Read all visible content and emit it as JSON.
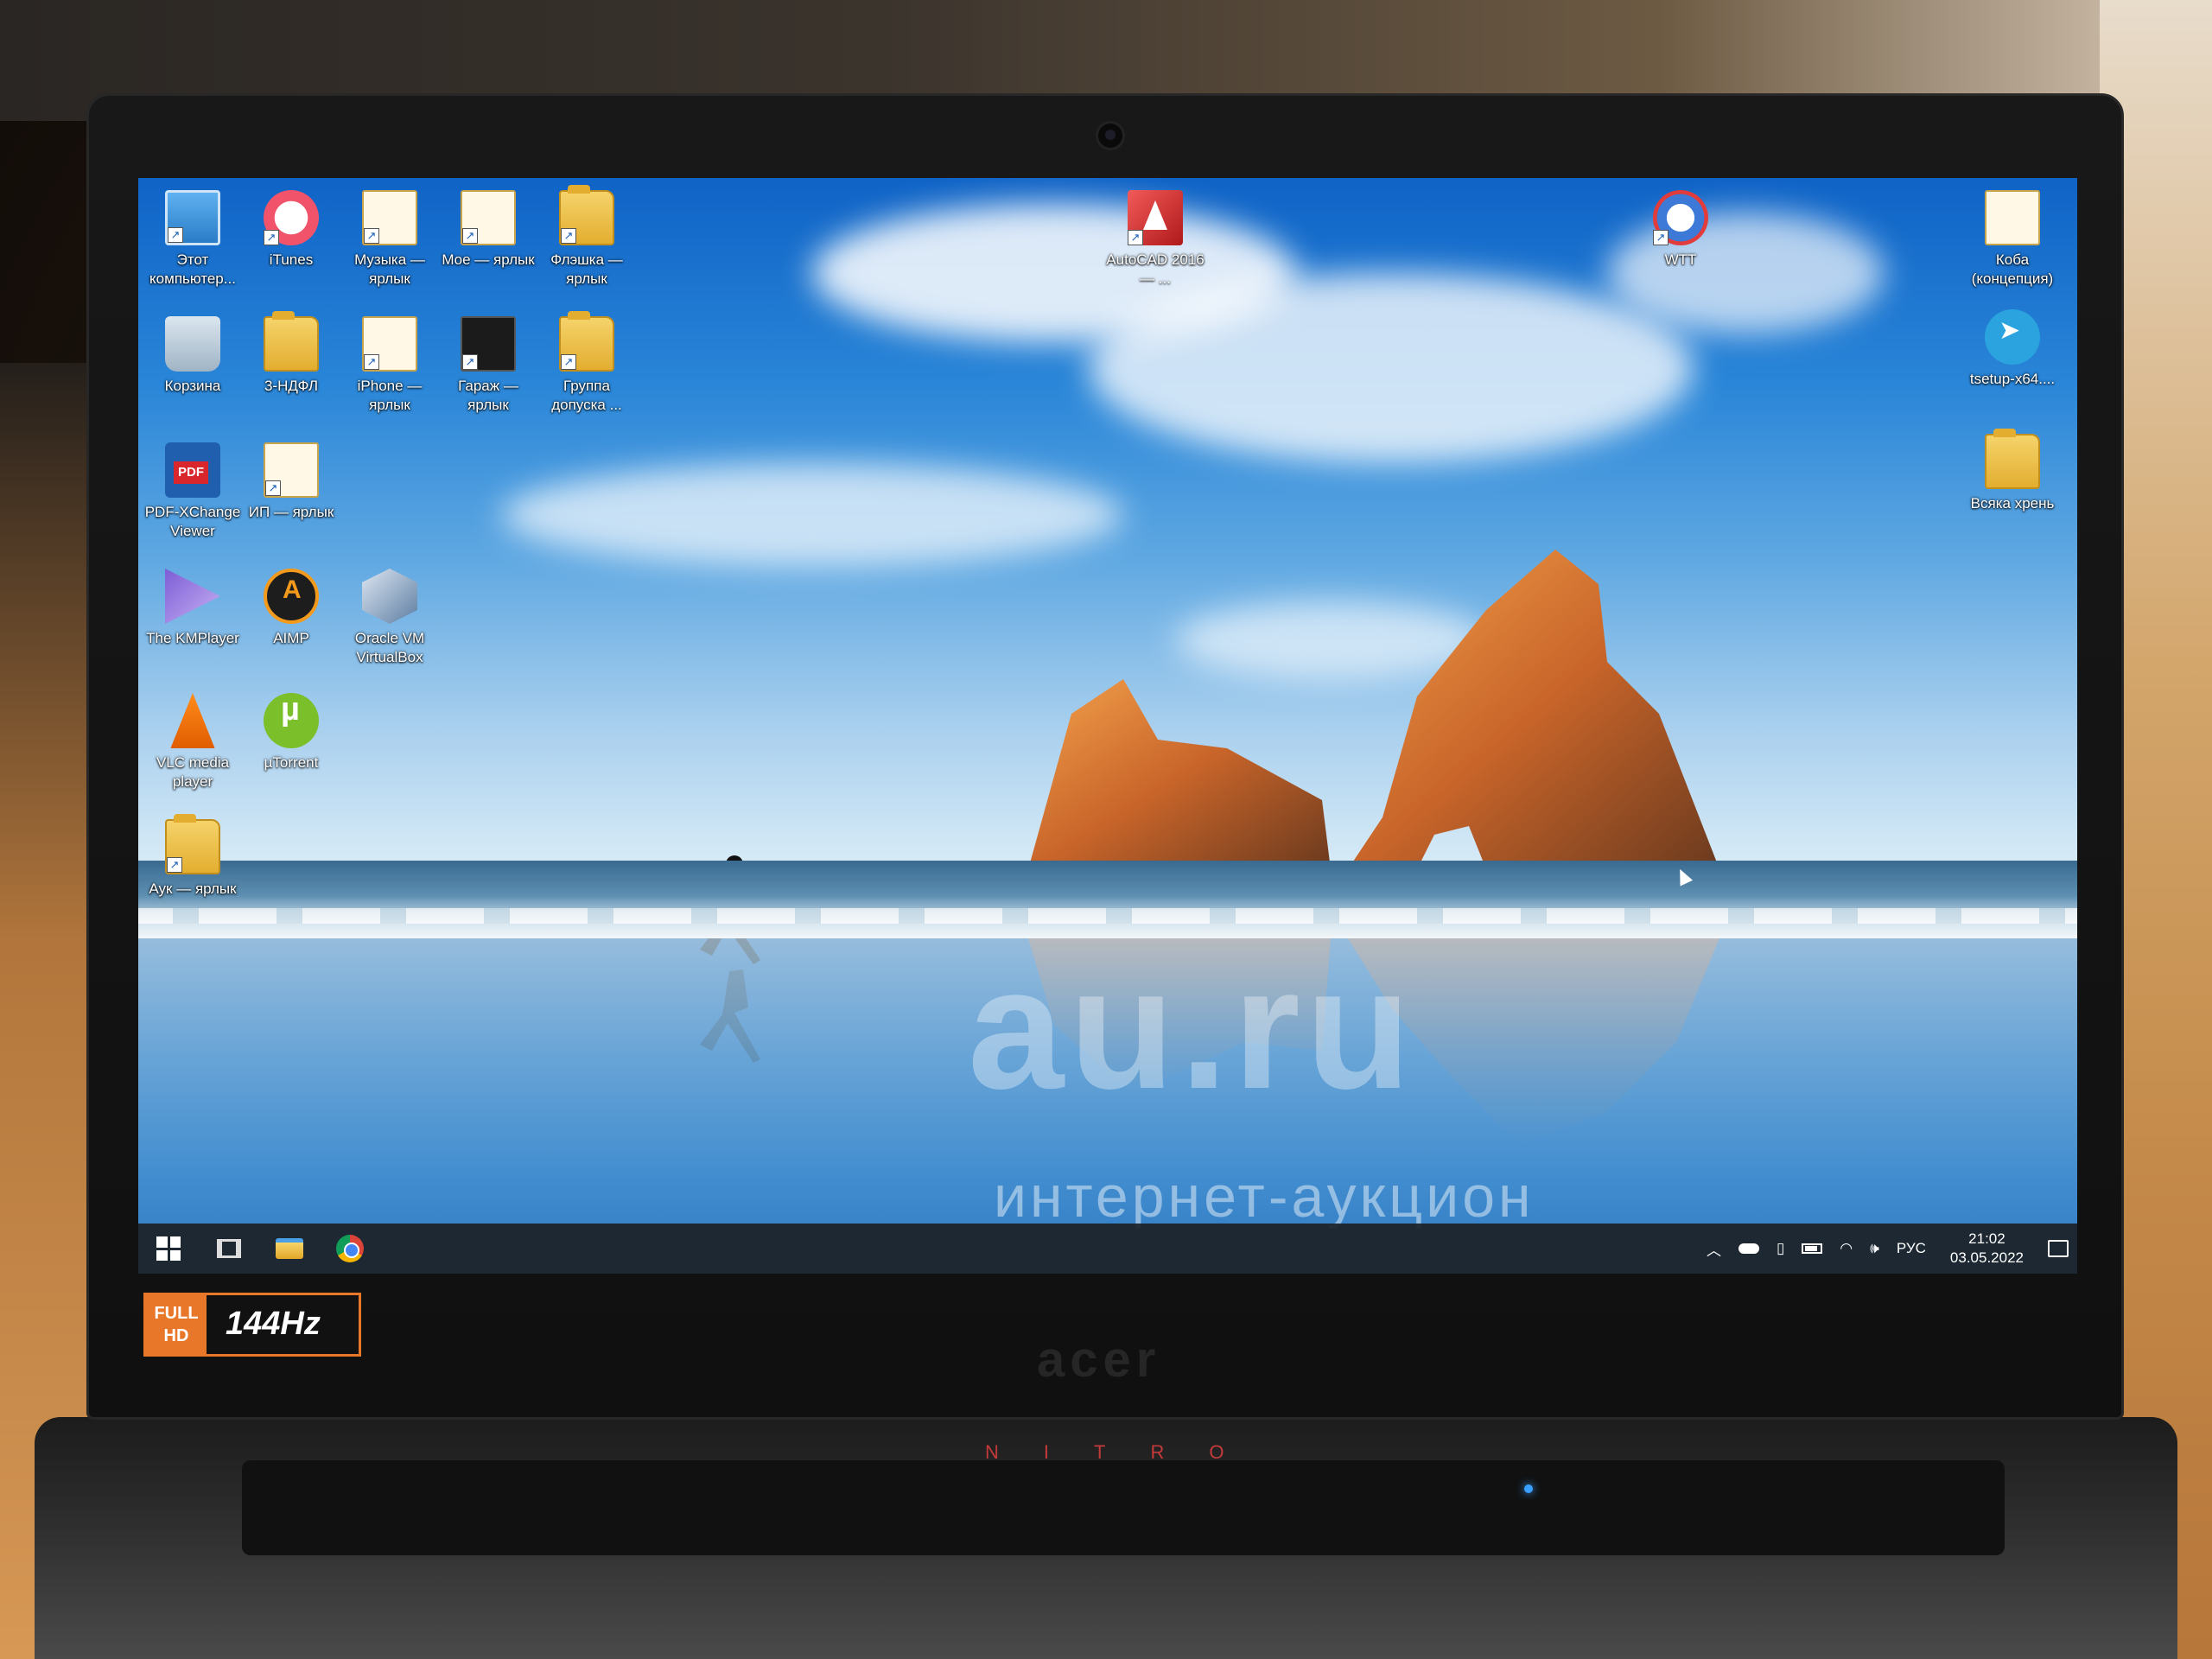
{
  "desktop_icons": [
    {
      "name": "icon-this-pc",
      "label": "Этот компьютер...",
      "icon": "computer-icon"
    },
    {
      "name": "icon-itunes",
      "label": "iTunes",
      "icon": "itunes-icon"
    },
    {
      "name": "icon-music-shortcut",
      "label": "Музыка — ярлык",
      "icon": "folder-icon"
    },
    {
      "name": "icon-my-shortcut",
      "label": "Мое — ярлык",
      "icon": "folder-icon"
    },
    {
      "name": "icon-flash-shortcut",
      "label": "Флэшка — ярлык",
      "icon": "folder-icon"
    },
    {
      "name": "icon-recycle-bin",
      "label": "Корзина",
      "icon": "recycle-bin-icon"
    },
    {
      "name": "icon-3ndfl",
      "label": "3-НДФЛ",
      "icon": "folder-icon"
    },
    {
      "name": "icon-iphone-shortcut",
      "label": "iPhone — ярлык",
      "icon": "folder-icon"
    },
    {
      "name": "icon-garage-shortcut",
      "label": "Гараж — ярлык",
      "icon": "document-icon"
    },
    {
      "name": "icon-group-shortcut",
      "label": "Группа допуска ...",
      "icon": "folder-icon"
    },
    {
      "name": "icon-pdf-xchange",
      "label": "PDF-XChange Viewer",
      "icon": "pdf-icon"
    },
    {
      "name": "icon-ip-shortcut",
      "label": "ИП — ярлык",
      "icon": "folder-icon"
    },
    {
      "name": "icon-kmplayer",
      "label": "The KMPlayer",
      "icon": "kmplayer-icon"
    },
    {
      "name": "icon-aimp",
      "label": "AIMP",
      "icon": "aimp-icon"
    },
    {
      "name": "icon-virtualbox",
      "label": "Oracle VM VirtualBox",
      "icon": "virtualbox-icon"
    },
    {
      "name": "icon-vlc",
      "label": "VLC media player",
      "icon": "vlc-icon"
    },
    {
      "name": "icon-utorrent",
      "label": "µTorrent",
      "icon": "utorrent-icon"
    },
    {
      "name": "icon-auk-shortcut",
      "label": "Аук — ярлык",
      "icon": "folder-icon"
    },
    {
      "name": "icon-autocad",
      "label": "AutoCAD 2016 — ...",
      "icon": "autocad-icon"
    },
    {
      "name": "icon-wtt",
      "label": "WTT",
      "icon": "wtt-icon"
    },
    {
      "name": "icon-koba",
      "label": "Коба (концепция)",
      "icon": "document-icon"
    },
    {
      "name": "icon-tsetup",
      "label": "tsetup-x64....",
      "icon": "telegram-icon"
    },
    {
      "name": "icon-vsyaka",
      "label": "Всяка хрень",
      "icon": "folder-icon"
    }
  ],
  "watermark": {
    "main": "au.ru",
    "sub": "интернет-аукцион"
  },
  "taskbar": {
    "pinned": [
      "start-icon",
      "task-view-icon",
      "file-explorer-icon",
      "chrome-icon"
    ],
    "tray": {
      "language": "РУС",
      "time": "21:02",
      "date": "03.05.2022"
    }
  },
  "bezel": {
    "badge_top": "FULL HD",
    "badge_hz": "144Hz",
    "brand": "acer",
    "model": "NITRO"
  }
}
